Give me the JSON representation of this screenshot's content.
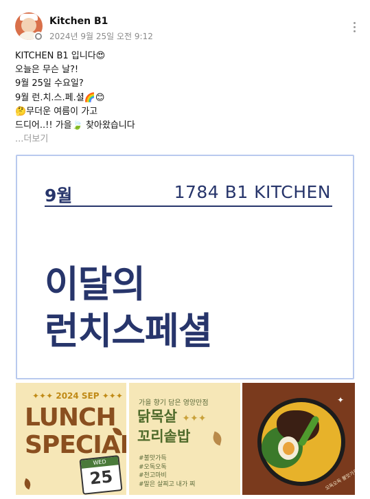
{
  "post": {
    "username": "Kitchen B1",
    "timestamp": "2024년 9월 25일 오전 9:12",
    "lines": [
      "KITCHEN B1 입니다😍",
      "오늘은 무슨 날?!",
      "9월 25일 수요일?",
      "9월 런.치.스.페.셜🌈😊",
      "🤔무더운 여름이 가고",
      "드디어..!! 가을🍃 찾아왔습니다"
    ],
    "more_label": "...더보기"
  },
  "banner": {
    "month": "9월",
    "kitchen": "1784 B1 KITCHEN",
    "line1": "이달의",
    "line2": "런치스페셜"
  },
  "thumbs": {
    "t1": {
      "year": "✦✦✦ 2024 SEP ✦✦✦",
      "lunch": "LUNCH",
      "special": "SPECIAL",
      "cal_head": "WED",
      "cal_day": "25"
    },
    "t2": {
      "tag": "가을 향기 담은 영양만점",
      "title1": "닭목살",
      "stars": "✦✦✦",
      "title2": "꼬리솥밥",
      "hashtags": [
        "#불맛가득",
        "#오독오독",
        "#천고마비",
        "#말은 살찌고 내가 찌"
      ]
    },
    "t3": {
      "note": "오독오독 불맛가득",
      "sparkle": "✦"
    }
  },
  "colors": {
    "navy": "#27356b",
    "banner_border": "#b8c9ee",
    "thumb_bg": "#f6e7b7",
    "brown": "#8a4f1f",
    "green": "#4e6a2a"
  },
  "icons": {
    "more": "more-vertical-icon",
    "avatar_badge": "badge-icon"
  }
}
